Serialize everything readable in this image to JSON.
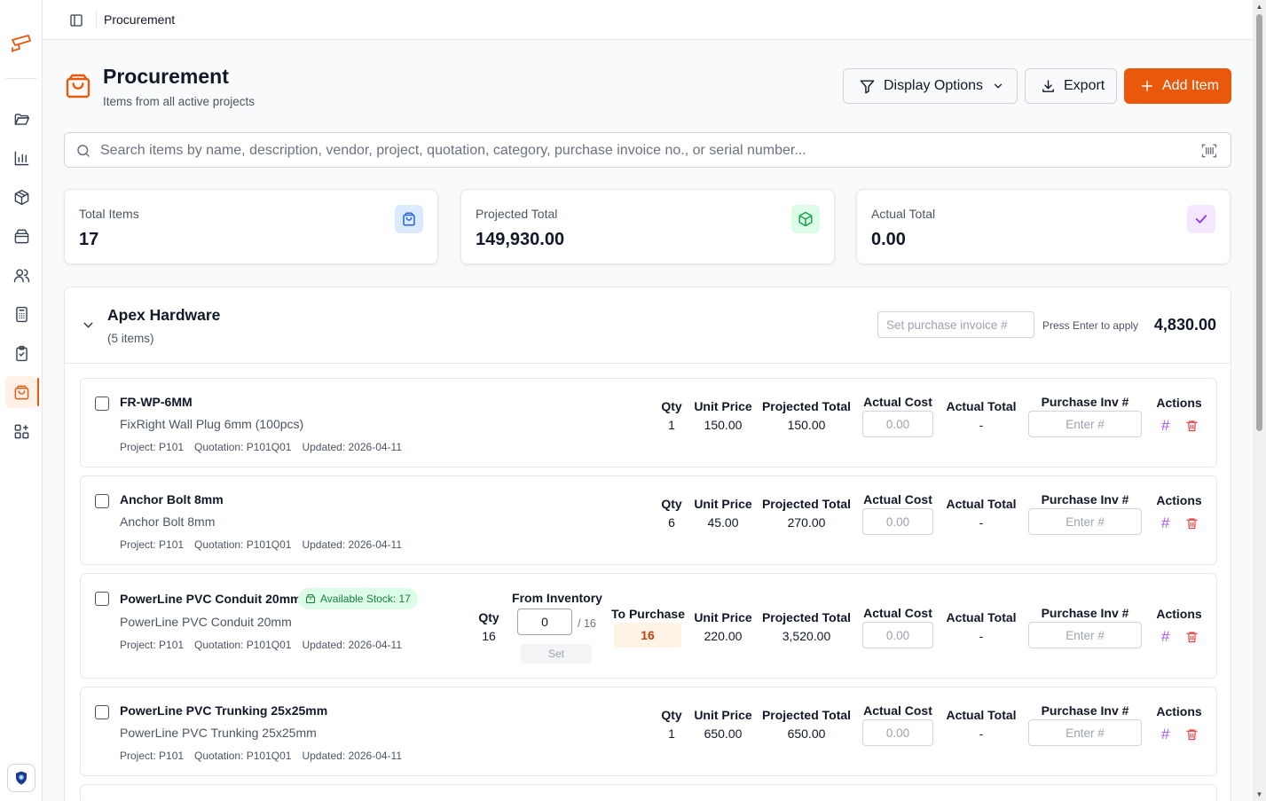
{
  "topbar": {
    "title": "Procurement"
  },
  "page": {
    "title": "Procurement",
    "subtitle": "Items from all active projects"
  },
  "toolbar": {
    "display_options": "Display Options",
    "export": "Export",
    "add_item": "Add Item"
  },
  "search": {
    "placeholder": "Search items by name, description, vendor, project, quotation, category, purchase invoice no., or serial number..."
  },
  "stats": {
    "total_items": {
      "label": "Total Items",
      "value": "17"
    },
    "projected_total": {
      "label": "Projected Total",
      "value": "149,930.00"
    },
    "actual_total": {
      "label": "Actual Total",
      "value": "0.00"
    }
  },
  "colors": {
    "accent": "#ea580c",
    "success": "#15803d",
    "danger": "#ef4444",
    "hash": "#a855f7"
  },
  "group": {
    "name": "Apex Hardware",
    "count": "(5 items)",
    "invoice_placeholder": "Set purchase invoice #",
    "hint": "Press Enter to apply",
    "total": "4,830.00"
  },
  "headers": {
    "qty": "Qty",
    "unit_price": "Unit Price",
    "projected_total": "Projected Total",
    "actual_cost": "Actual Cost",
    "actual_total": "Actual Total",
    "purchase_inv": "Purchase Inv #",
    "actions": "Actions",
    "from_inventory": "From Inventory",
    "to_purchase": "To Purchase"
  },
  "items": [
    {
      "code": "FR-WP-6MM",
      "desc": "FixRight Wall Plug 6mm (100pcs)",
      "project": "Project: P101",
      "quotation": "Quotation: P101Q01",
      "updated": "Updated: 2026-04-11",
      "qty": "1",
      "unit_price": "150.00",
      "projected_total": "150.00",
      "actual_cost_placeholder": "0.00",
      "actual_total": "-",
      "inv_placeholder": "Enter #"
    },
    {
      "code": "Anchor Bolt 8mm",
      "desc": "Anchor Bolt 8mm",
      "project": "Project: P101",
      "quotation": "Quotation: P101Q01",
      "updated": "Updated: 2026-04-11",
      "qty": "6",
      "unit_price": "45.00",
      "projected_total": "270.00",
      "actual_cost_placeholder": "0.00",
      "actual_total": "-",
      "inv_placeholder": "Enter #"
    },
    {
      "code": "PowerLine PVC Conduit 20mm",
      "badge": "Available Stock: 17",
      "desc": "PowerLine PVC Conduit 20mm",
      "project": "Project: P101",
      "quotation": "Quotation: P101Q01",
      "updated": "Updated: 2026-04-11",
      "qty": "16",
      "from_inventory_value": "0",
      "from_inventory_of": "/ 16",
      "set_label": "Set",
      "to_purchase": "16",
      "unit_price": "220.00",
      "projected_total": "3,520.00",
      "actual_cost_placeholder": "0.00",
      "actual_total": "-",
      "inv_placeholder": "Enter #"
    },
    {
      "code": "PowerLine PVC Trunking 25x25mm",
      "desc": "PowerLine PVC Trunking 25x25mm",
      "project": "Project: P101",
      "quotation": "Quotation: P101Q01",
      "updated": "Updated: 2026-04-11",
      "qty": "1",
      "unit_price": "650.00",
      "projected_total": "650.00",
      "actual_cost_placeholder": "0.00",
      "actual_total": "-",
      "inv_placeholder": "Enter #"
    }
  ],
  "icons": {
    "sidebar": [
      "logo-icon",
      "folder-icon",
      "chart-icon",
      "box-icon",
      "package-icon",
      "users-icon",
      "calculator-icon",
      "clipboard-icon",
      "shopping-bag-icon",
      "apps-icon",
      "shield-icon"
    ]
  }
}
